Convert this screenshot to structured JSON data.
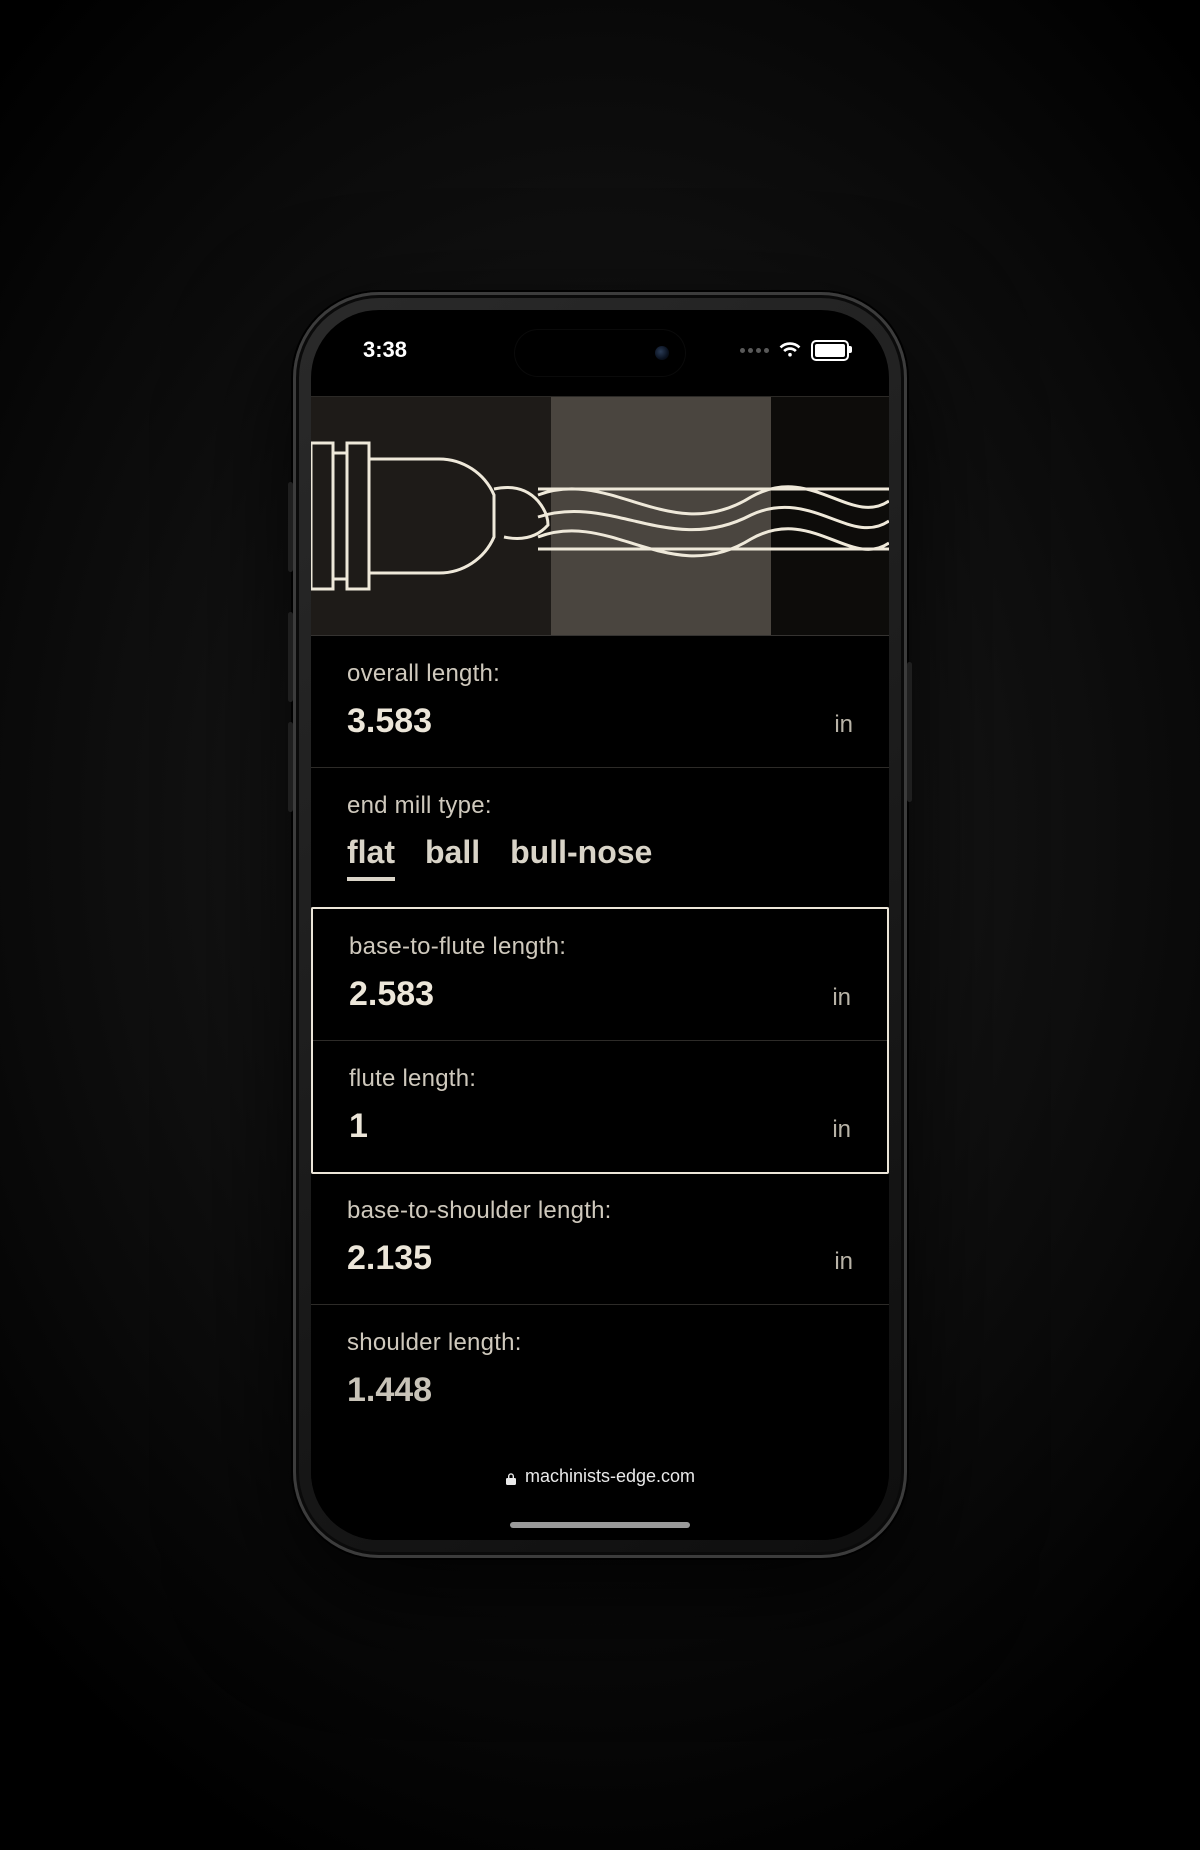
{
  "status": {
    "time": "3:38"
  },
  "browser": {
    "domain": "machinists-edge.com"
  },
  "units": {
    "length": "in"
  },
  "end_mill_type": {
    "label": "end mill type:",
    "options": [
      "flat",
      "ball",
      "bull-nose"
    ],
    "selected": "flat"
  },
  "fields": {
    "overall_length": {
      "label": "overall length:",
      "value": "3.583"
    },
    "base_to_flute_length": {
      "label": "base-to-flute length:",
      "value": "2.583"
    },
    "flute_length": {
      "label": "flute length:",
      "value": "1"
    },
    "base_to_shoulder_length": {
      "label": "base-to-shoulder length:",
      "value": "2.135"
    },
    "shoulder_length": {
      "label": "shoulder length:",
      "value": "1.448"
    }
  }
}
